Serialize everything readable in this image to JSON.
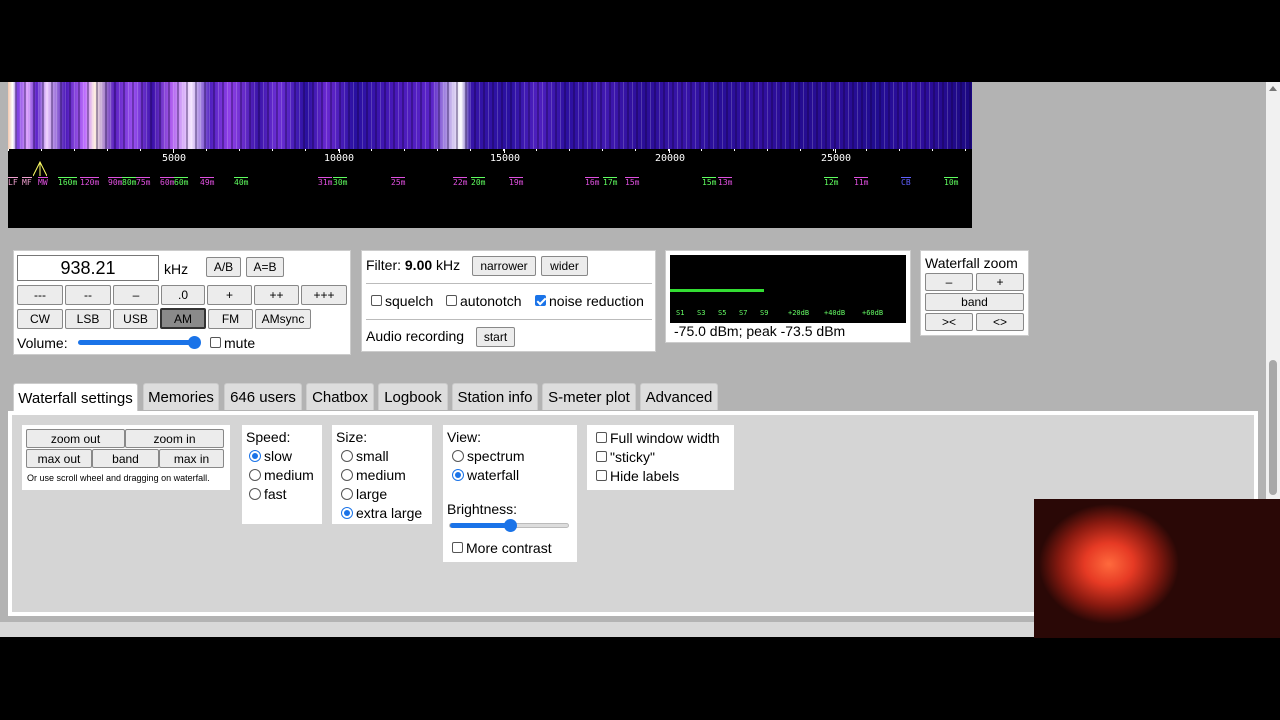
{
  "scale": {
    "ticks": [
      "5000",
      "10000",
      "15000",
      "20000",
      "25000"
    ],
    "bands": [
      {
        "label": "LF",
        "color": "#f0a0d0"
      },
      {
        "label": "MF",
        "color": "#f0a0d0"
      },
      {
        "label": "MW",
        "color": "#e050e0"
      },
      {
        "label": "160m",
        "color": "#60ff60"
      },
      {
        "label": "120m",
        "color": "#e050e0"
      },
      {
        "label": "90m",
        "color": "#e050e0"
      },
      {
        "label": "80m",
        "color": "#60ff60"
      },
      {
        "label": "75m",
        "color": "#e050e0"
      },
      {
        "label": "60m",
        "color": "#e050e0"
      },
      {
        "label": "60m",
        "color": "#60ff60"
      },
      {
        "label": "49m",
        "color": "#e050e0"
      },
      {
        "label": "40m",
        "color": "#60ff60"
      },
      {
        "label": "31m",
        "color": "#e050e0"
      },
      {
        "label": "30m",
        "color": "#60ff60"
      },
      {
        "label": "25m",
        "color": "#e050e0"
      },
      {
        "label": "22m",
        "color": "#e050e0"
      },
      {
        "label": "20m",
        "color": "#60ff60"
      },
      {
        "label": "19m",
        "color": "#e050e0"
      },
      {
        "label": "16m",
        "color": "#e050e0"
      },
      {
        "label": "17m",
        "color": "#60ff60"
      },
      {
        "label": "15m",
        "color": "#e050e0"
      },
      {
        "label": "15m",
        "color": "#60ff60"
      },
      {
        "label": "13m",
        "color": "#e050e0"
      },
      {
        "label": "12m",
        "color": "#60ff60"
      },
      {
        "label": "11m",
        "color": "#e050e0"
      },
      {
        "label": "CB",
        "color": "#6060ff"
      },
      {
        "label": "10m",
        "color": "#60ff60"
      }
    ]
  },
  "tuning": {
    "frequency": "938.21",
    "unit": "kHz",
    "ab": "A/B",
    "aeqb": "A=B",
    "steps": [
      "---",
      "--",
      "–",
      ".0",
      "+",
      "++",
      "+++"
    ],
    "modes": [
      "CW",
      "LSB",
      "USB",
      "AM",
      "FM",
      "AMsync"
    ],
    "active_mode": "AM",
    "volume_label": "Volume:",
    "volume_level": 0.95,
    "mute_label": "mute",
    "mute_checked": false
  },
  "filter": {
    "label": "Filter:",
    "value": "9.00",
    "unit": "kHz",
    "narrower": "narrower",
    "wider": "wider",
    "squelch": "squelch",
    "autonotch": "autonotch",
    "noise_reduction": "noise reduction",
    "squelch_checked": false,
    "autonotch_checked": false,
    "noise_reduction_checked": true,
    "recording_label": "Audio recording",
    "start": "start"
  },
  "smeter": {
    "scale": [
      "S1",
      "S3",
      "S5",
      "S7",
      "S9",
      "+20dB",
      "+40dB",
      "+60dB"
    ],
    "level": 0.4,
    "readout": "-75.0 dBm; peak  -73.5 dBm"
  },
  "zoom": {
    "title": "Waterfall zoom",
    "minus": "–",
    "plus": "+",
    "band": "band",
    "left": "><",
    "right": "<>"
  },
  "tabs": [
    "Waterfall settings",
    "Memories",
    "646 users",
    "Chatbox",
    "Logbook",
    "Station info",
    "S-meter plot",
    "Advanced"
  ],
  "active_tab": "Waterfall settings",
  "wf_settings": {
    "zoom_out": "zoom out",
    "zoom_in": "zoom in",
    "max_out": "max out",
    "band": "band",
    "max_in": "max in",
    "hint": "Or use scroll wheel and dragging on waterfall.",
    "speed_label": "Speed:",
    "speeds": [
      "slow",
      "medium",
      "fast"
    ],
    "speed_selected": "slow",
    "size_label": "Size:",
    "sizes": [
      "small",
      "medium",
      "large",
      "extra large"
    ],
    "size_selected": "extra large",
    "view_label": "View:",
    "views": [
      "spectrum",
      "waterfall"
    ],
    "view_selected": "waterfall",
    "brightness_label": "Brightness:",
    "brightness_level": 0.5,
    "more_contrast": "More contrast",
    "full_width": "Full window width",
    "sticky": "\"sticky\"",
    "hide_labels": "Hide labels"
  },
  "colors": {
    "accent": "#1a73e8",
    "page_bg": "#b3b3b3",
    "smeter_bar": "#33dd33"
  }
}
